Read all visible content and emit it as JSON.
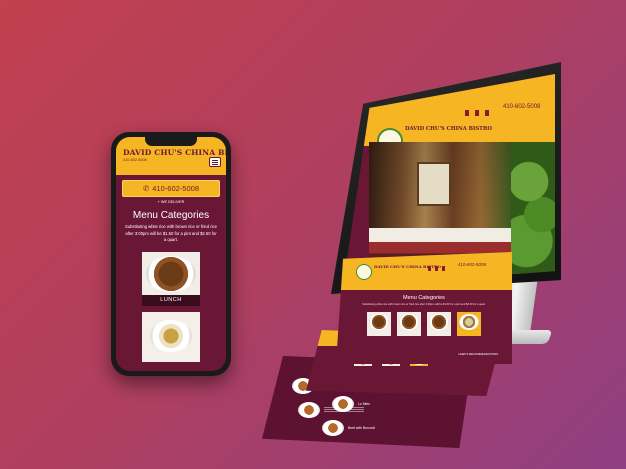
{
  "phone": {
    "brand_title": "DAVID CHU'S CHINA BISTRO",
    "brand_subtitle": "410-602-5008",
    "phone_number": "410-602-5008",
    "deliver_text": "WE DELIVER",
    "menu_heading": "Menu Categories",
    "menu_note": "Substituting white rice with brown rice or fried rice after 3:00pm will be $1.50 for a pint and $2.50 for a quart.",
    "card_1_label": "LUNCH"
  },
  "desktop": {
    "brand_title": "DAVID CHU'S CHINA BISTRO",
    "phone_number": "410-602-5008",
    "menu_heading": "Menu Categories",
    "thumb_label": "CHEF'S RECOMMENDATIONS"
  },
  "lunch_page": {
    "heading": "Lunch Menu",
    "items": [
      "Chicken with Broccoli",
      "Sweet and Sour Chicken",
      "Lo Mein",
      "Beef with Broccoli"
    ]
  },
  "colors": {
    "background_start": "#c2404f",
    "background_end": "#8f3f83",
    "brand_maroon": "#6a1635",
    "brand_yellow": "#f6b623"
  },
  "icons": [
    "phone-icon",
    "hamburger-menu-icon",
    "logo-icon"
  ]
}
